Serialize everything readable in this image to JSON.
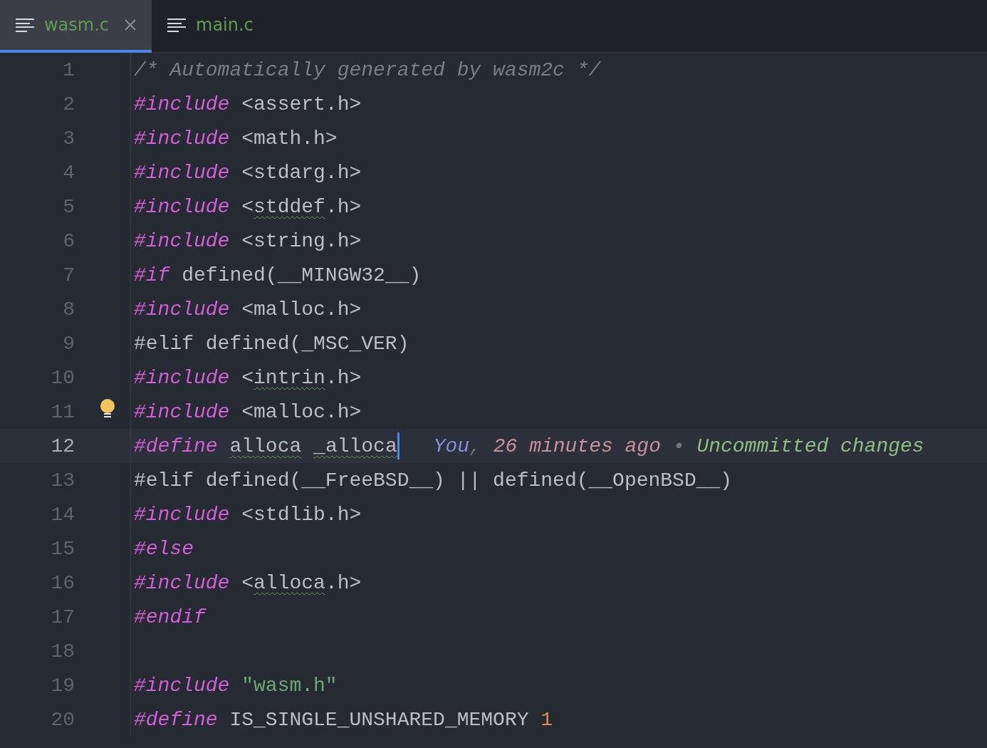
{
  "tabs": [
    {
      "label": "wasm.c",
      "selected": true,
      "closable": true
    },
    {
      "label": "main.c",
      "selected": false,
      "closable": false
    }
  ],
  "editor": {
    "lines": [
      {
        "number": "1",
        "tokens": [
          {
            "text": "/* Automatically generated by wasm2c */",
            "kind": "comment"
          }
        ]
      },
      {
        "number": "2",
        "tokens": [
          {
            "text": "#include",
            "kind": "directive"
          },
          {
            "text": " <assert.h>",
            "kind": "plain"
          }
        ]
      },
      {
        "number": "3",
        "tokens": [
          {
            "text": "#include",
            "kind": "directive"
          },
          {
            "text": " <math.h>",
            "kind": "plain"
          }
        ]
      },
      {
        "number": "4",
        "tokens": [
          {
            "text": "#include",
            "kind": "directive"
          },
          {
            "text": " <stdarg.h>",
            "kind": "plain"
          }
        ]
      },
      {
        "number": "5",
        "tokens": [
          {
            "text": "#include",
            "kind": "directive"
          },
          {
            "text": " <",
            "kind": "plain"
          },
          {
            "text": "stddef",
            "kind": "plain",
            "squiggle": true
          },
          {
            "text": ".h>",
            "kind": "plain"
          }
        ]
      },
      {
        "number": "6",
        "tokens": [
          {
            "text": "#include",
            "kind": "directive"
          },
          {
            "text": " <string.h>",
            "kind": "plain"
          }
        ]
      },
      {
        "number": "7",
        "tokens": [
          {
            "text": "#if",
            "kind": "directive"
          },
          {
            "text": " defined(__MINGW32__)",
            "kind": "plain"
          }
        ]
      },
      {
        "number": "8",
        "tokens": [
          {
            "text": "#include",
            "kind": "directive"
          },
          {
            "text": " <malloc.h>",
            "kind": "plain"
          }
        ]
      },
      {
        "number": "9",
        "tokens": [
          {
            "text": "#elif defined(_MSC_VER)",
            "kind": "plain"
          }
        ]
      },
      {
        "number": "10",
        "tokens": [
          {
            "text": "#include",
            "kind": "directive"
          },
          {
            "text": " <",
            "kind": "plain"
          },
          {
            "text": "intrin",
            "kind": "plain",
            "squiggle": true
          },
          {
            "text": ".h>",
            "kind": "plain"
          }
        ]
      },
      {
        "number": "11",
        "lightbulb": true,
        "tokens": [
          {
            "text": "#include",
            "kind": "directive"
          },
          {
            "text": " <malloc.h>",
            "kind": "plain"
          }
        ]
      },
      {
        "number": "12",
        "current": true,
        "tokens": [
          {
            "text": "#define",
            "kind": "directive"
          },
          {
            "text": " alloca",
            "kind": "plain",
            "squiggle": true
          },
          {
            "text": " _alloca",
            "kind": "plain",
            "squiggle": true
          }
        ],
        "annotation": [
          {
            "text": "You",
            "kind": "author"
          },
          {
            "text": ", ",
            "kind": "sep"
          },
          {
            "text": "26 minutes ago",
            "kind": "time"
          },
          {
            "text": " • ",
            "kind": "sep"
          },
          {
            "text": "Uncommitted changes",
            "kind": "status"
          }
        ]
      },
      {
        "number": "13",
        "tokens": [
          {
            "text": "#elif defined(__FreeBSD__) || defined(__OpenBSD__)",
            "kind": "plain"
          }
        ]
      },
      {
        "number": "14",
        "tokens": [
          {
            "text": "#include",
            "kind": "directive"
          },
          {
            "text": " <stdlib.h>",
            "kind": "plain"
          }
        ]
      },
      {
        "number": "15",
        "tokens": [
          {
            "text": "#else",
            "kind": "directive"
          }
        ]
      },
      {
        "number": "16",
        "tokens": [
          {
            "text": "#include",
            "kind": "directive"
          },
          {
            "text": " <",
            "kind": "plain"
          },
          {
            "text": "alloca",
            "kind": "plain",
            "squiggle": true
          },
          {
            "text": ".h>",
            "kind": "plain"
          }
        ]
      },
      {
        "number": "17",
        "tokens": [
          {
            "text": "#endif",
            "kind": "directive"
          }
        ]
      },
      {
        "number": "18"
      },
      {
        "number": "19",
        "tokens": [
          {
            "text": "#include",
            "kind": "directive"
          },
          {
            "text": " \"wasm.h\"",
            "kind": "string"
          }
        ]
      },
      {
        "number": "20",
        "tokens": [
          {
            "text": "#define",
            "kind": "directive"
          },
          {
            "text": " IS_SINGLE_UNSHARED_MEMORY ",
            "kind": "plain"
          },
          {
            "text": "1",
            "kind": "number"
          }
        ]
      }
    ]
  }
}
